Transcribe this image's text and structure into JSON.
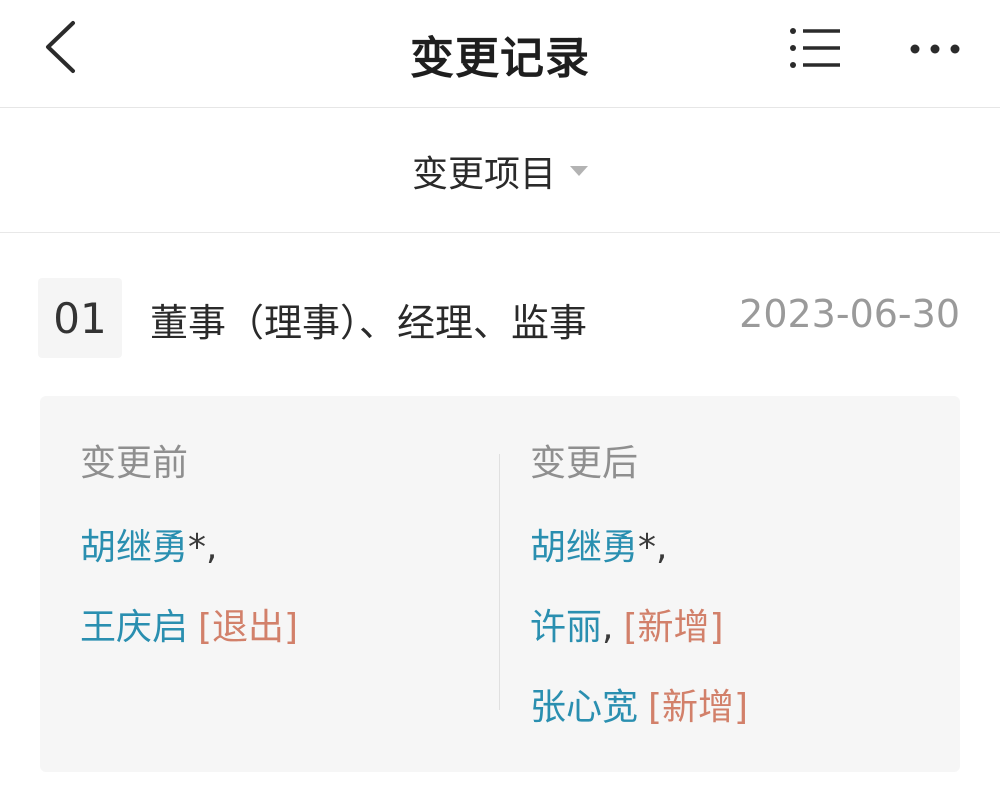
{
  "nav": {
    "title": "变更记录",
    "back_icon": "chevron-left-icon",
    "list_icon": "list-icon",
    "more_icon": "more-horizontal-icon"
  },
  "filter": {
    "label": "变更项目",
    "caret_icon": "caret-down-icon"
  },
  "record": {
    "index": "01",
    "item": "董事（理事）、经理、监事",
    "date": "2023-06-30",
    "before": {
      "title": "变更前",
      "entries": [
        {
          "name": "胡继勇",
          "suffix": "*,",
          "tag": ""
        },
        {
          "name": "王庆启",
          "suffix": "",
          "tag": "[退出]"
        }
      ]
    },
    "after": {
      "title": "变更后",
      "entries": [
        {
          "name": "胡继勇",
          "suffix": "*,",
          "tag": ""
        },
        {
          "name": "许丽",
          "suffix": ",",
          "tag": "[新增]"
        },
        {
          "name": "张心宽",
          "suffix": "",
          "tag": "[新增]"
        }
      ]
    }
  },
  "colors": {
    "name_link": "#2a8fb0",
    "tag": "#d2806a",
    "date": "#9a9a9a",
    "card_bg": "#f6f6f6"
  }
}
